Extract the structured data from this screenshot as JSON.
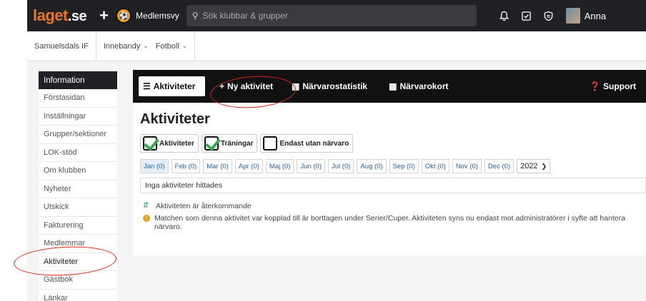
{
  "topbar": {
    "logo_main": "laget",
    "logo_suffix": ".se",
    "plus_icon": "+",
    "club_badge_icon": "club-crest-icon",
    "memberview_label": "Medlemsvy",
    "search_placeholder": "Sök klubbar & grupper",
    "icons": [
      "bell-icon",
      "checkbox-icon",
      "shield-icon"
    ],
    "user_name": "Anna"
  },
  "subnav": {
    "club": "Samuelsdals IF",
    "items": [
      {
        "label": "Innebandy"
      },
      {
        "label": "Fotboll"
      }
    ]
  },
  "sidebar": {
    "header": "Information",
    "items": [
      {
        "label": "Förstasidan"
      },
      {
        "label": "Inställningar"
      },
      {
        "label": "Grupper/sektioner"
      },
      {
        "label": "LOK-stöd"
      },
      {
        "label": "Om klubben"
      },
      {
        "label": "Nyheter"
      },
      {
        "label": "Utskick"
      },
      {
        "label": "Fakturering"
      },
      {
        "label": "Medlemmar"
      },
      {
        "label": "Aktiviteter",
        "active": true
      },
      {
        "label": "Gästbok"
      },
      {
        "label": "Länkar"
      }
    ]
  },
  "toolbar": {
    "activities": "Aktiviteter",
    "new_activity": "Ny aktivitet",
    "attendance_stats": "Närvarostatistik",
    "attendance_card": "Närvarokort",
    "support": "Support"
  },
  "main": {
    "title": "Aktiviteter",
    "filters": [
      {
        "label": "Aktiviteter",
        "checked": true
      },
      {
        "label": "Träningar",
        "checked": true
      },
      {
        "label": "Endast utan närvaro",
        "checked": false
      }
    ],
    "months": [
      "Jan (0)",
      "Feb (0)",
      "Mar (0)",
      "Apr (0)",
      "Maj (0)",
      "Jun (0)",
      "Jul (0)",
      "Aug (0)",
      "Sep (0)",
      "Okt (0)",
      "Nov (0)",
      "Dec (0)"
    ],
    "year": "2022",
    "empty_text": "Inga aktiviteter hittades",
    "note_recurring": "Aktiviteten är återkommande",
    "note_deleted": "Matchen som denna aktivitet var kopplad till är borttagen under Serier/Cuper. Aktiviteten syns nu endast mot administratörer i syfte att hantera närvaro."
  }
}
